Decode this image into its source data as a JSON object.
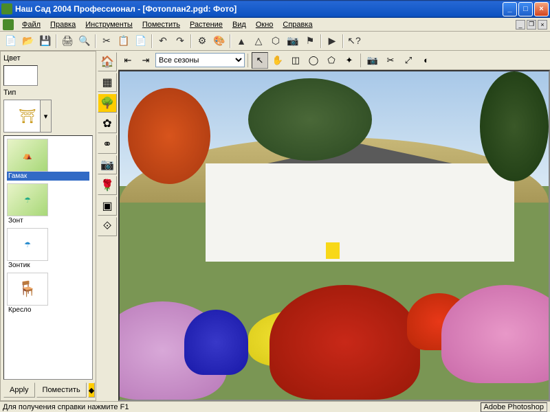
{
  "window": {
    "title": "Наш Сад 2004 Профессионал - [Фотоплан2.pgd: Фото]"
  },
  "menu": {
    "file": "Файл",
    "edit": "Правка",
    "tools": "Инструменты",
    "place": "Поместить",
    "plant": "Растение",
    "view": "Вид",
    "window": "Окно",
    "help": "Справка"
  },
  "left": {
    "color_label": "Цвет",
    "type_label": "Тип",
    "items": [
      {
        "label": "Гамак"
      },
      {
        "label": "Зонт"
      },
      {
        "label": "Зонтик"
      },
      {
        "label": "Кресло"
      }
    ],
    "apply": "Apply",
    "place": "Поместить"
  },
  "photobar": {
    "season_selected": "Все сезоны"
  },
  "status": {
    "help": "Для получения справки нажмите F1",
    "tray": "Adobe Photoshop"
  }
}
